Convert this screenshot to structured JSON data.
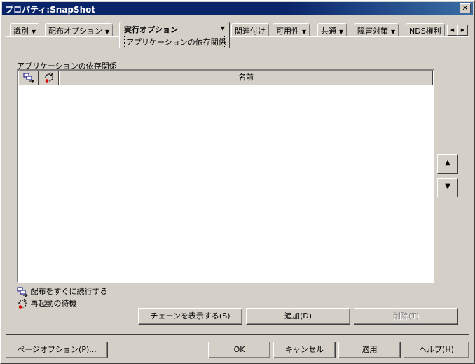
{
  "window": {
    "title": "プロパティ:SnapShot",
    "close_glyph": "✕"
  },
  "tabs": [
    {
      "label": "識別"
    },
    {
      "label": "配布オプション"
    },
    {
      "label": "実行オプション",
      "sub": "アプリケーションの依存関係",
      "active": true
    },
    {
      "label": "関連付け"
    },
    {
      "label": "可用性"
    },
    {
      "label": "共通"
    },
    {
      "label": "障害対策"
    },
    {
      "label": "NDS権利"
    }
  ],
  "tab_scroll": {
    "left_glyph": "◀",
    "right_glyph": "▶"
  },
  "dependencies": {
    "group_label": "アプリケーションの依存関係",
    "columns": {
      "chain_icon": "chain-icon",
      "restart_icon": "restart-icon",
      "name": "名前"
    },
    "rows": []
  },
  "side_buttons": {
    "up_glyph": "▲",
    "down_glyph": "▼"
  },
  "legend": {
    "chain": "配布をすぐに続行する",
    "restart": "再起動の待機"
  },
  "actions": {
    "show_chain": "チェーンを表示する(S)",
    "add": "追加(D)",
    "delete": "削除(T)"
  },
  "footer": {
    "page_options": "ページオプション(P)...",
    "ok": "OK",
    "cancel": "キャンセル",
    "apply": "適用",
    "help": "ヘルプ(H)"
  }
}
